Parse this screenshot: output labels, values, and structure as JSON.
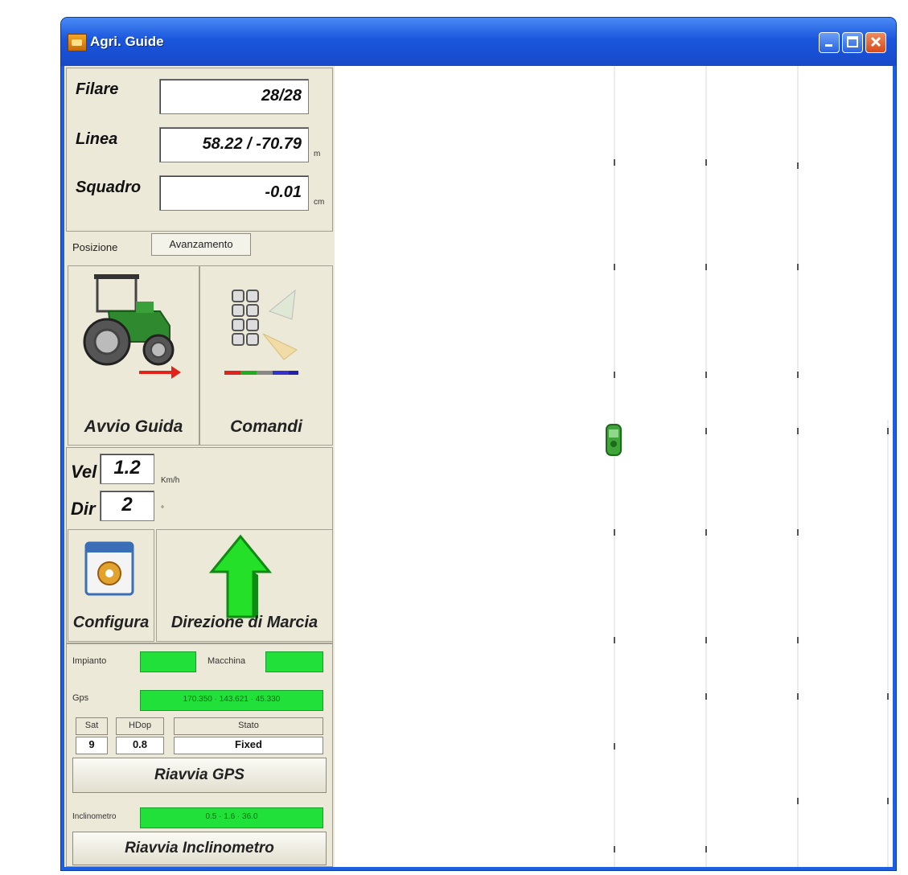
{
  "window": {
    "title": "Agri. Guide"
  },
  "fields": {
    "filare": {
      "label": "Filare",
      "value": "28/28",
      "unit": ""
    },
    "linea": {
      "label": "Linea",
      "value": "58.22 / -70.79",
      "unit": "m"
    },
    "squadro": {
      "label": "Squadro",
      "value": "-0.01",
      "unit": "cm"
    }
  },
  "tabs": {
    "posizione": "Posizione",
    "avanzamento": "Avanzamento"
  },
  "buttons": {
    "avvio_guida": "Avvio Guida",
    "comandi": "Comandi",
    "configura": "Configura",
    "direzione": "Direzione di Marcia",
    "riavvia_gps": "Riavvia GPS",
    "riavvia_inclinometro": "Riavvia Inclinometro"
  },
  "motion": {
    "vel_label": "Vel",
    "vel_value": "1.2",
    "vel_unit": "Km/h",
    "dir_label": "Dir",
    "dir_value": "2",
    "dir_unit": "°"
  },
  "status": {
    "impianto": "Impianto",
    "macchina": "Macchina",
    "gps_label": "Gps",
    "gps_value": "170.350 · 143.621 · 45.330",
    "sat_hdr": "Sat",
    "hdop_hdr": "HDop",
    "stato_hdr": "Stato",
    "sat_val": "9",
    "hdop_val": "0.8",
    "stato_val": "Fixed",
    "inclinometro_label": "Inclinometro",
    "inclinometro_value": "0.5 · 1.6 · 36.0"
  },
  "colors": {
    "accent_green": "#22e03a",
    "window_blue": "#1d5fe0",
    "panel_bg": "#ece9d8"
  },
  "icons": {
    "app": "app-icon",
    "tractor": "tractor-icon",
    "commands": "commands-icon",
    "config": "config-icon",
    "arrow": "arrow-up-icon"
  }
}
